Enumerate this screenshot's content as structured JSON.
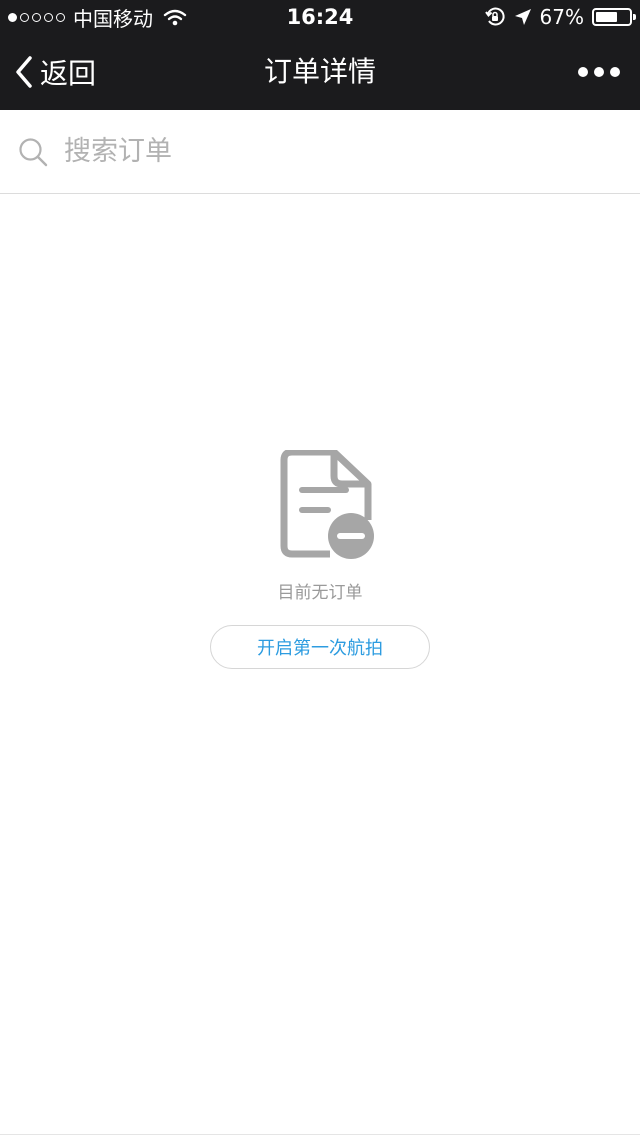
{
  "status_bar": {
    "carrier": "中国移动",
    "time": "16:24",
    "battery": "67%",
    "battery_level": 0.67,
    "signal_strength": 1,
    "signal_total": 5
  },
  "nav": {
    "back_label": "返回",
    "title": "订单详情",
    "more_icon": "more-icon"
  },
  "search": {
    "placeholder": "搜索订单",
    "icon": "search-icon"
  },
  "empty_state": {
    "icon": "document-empty-icon",
    "message": "目前无订单",
    "action_label": "开启第一次航拍"
  },
  "colors": {
    "bar_background": "#1b1b1d",
    "accent": "#2d9ce0",
    "muted_text": "#9a9a9a",
    "icon_gray": "#a6a6a6"
  }
}
